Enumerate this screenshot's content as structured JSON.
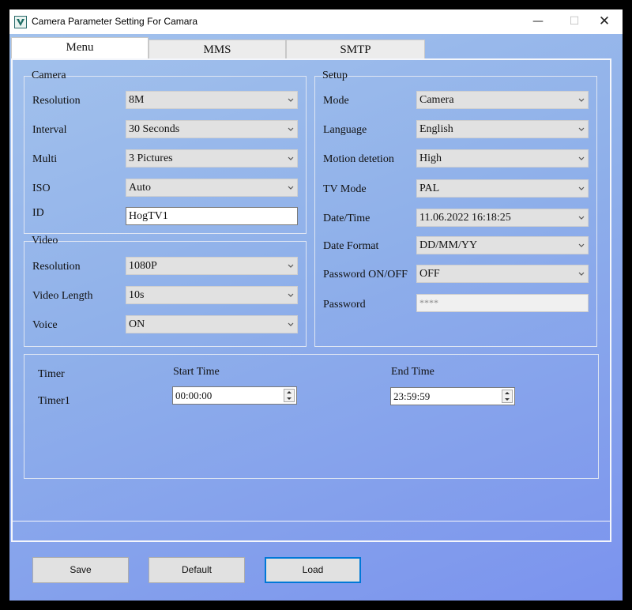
{
  "window": {
    "title": "Camera Parameter Setting For  Camara",
    "controls": {
      "minimize": "—",
      "maximize": "☐",
      "close": "✕"
    }
  },
  "tabs": [
    {
      "label": "Menu",
      "active": true
    },
    {
      "label": "MMS",
      "active": false
    },
    {
      "label": "SMTP",
      "active": false
    }
  ],
  "camera": {
    "title": "Camera",
    "resolution": {
      "label": "Resolution",
      "value": "8M"
    },
    "interval": {
      "label": "Interval",
      "value": "30 Seconds"
    },
    "multi": {
      "label": "Multi",
      "value": "3 Pictures"
    },
    "iso": {
      "label": "ISO",
      "value": "Auto"
    },
    "id": {
      "label": "ID",
      "value": "HogTV1"
    }
  },
  "video": {
    "title": "Video",
    "resolution": {
      "label": "Resolution",
      "value": "1080P"
    },
    "length": {
      "label": "Video Length",
      "value": "10s"
    },
    "voice": {
      "label": "Voice",
      "value": "ON"
    }
  },
  "setup": {
    "title": "Setup",
    "mode": {
      "label": "Mode",
      "value": "Camera"
    },
    "language": {
      "label": "Language",
      "value": "English"
    },
    "motion": {
      "label": "Motion detetion",
      "value": "High"
    },
    "tvmode": {
      "label": "TV Mode",
      "value": "PAL"
    },
    "datetime": {
      "label": "Date/Time",
      "value": "11.06.2022 16:18:25"
    },
    "dateformat": {
      "label": "Date Format",
      "value": "DD/MM/YY"
    },
    "password_onoff": {
      "label": "Password ON/OFF",
      "value": "OFF"
    },
    "password": {
      "label": "Password",
      "value": "****"
    }
  },
  "timer": {
    "label": "Timer",
    "start_label": "Start Time",
    "end_label": "End Time",
    "row_label": "Timer1",
    "start_value": "00:00:00",
    "end_value": "23:59:59"
  },
  "buttons": {
    "save": "Save",
    "default": "Default",
    "load": "Load"
  },
  "colors": {
    "accent": "#0078d7",
    "background_top": "#a4c3ec",
    "background_bottom": "#7b93ee"
  },
  "icons": [
    "app-icon",
    "dropdown-arrow-icon",
    "spin-up-icon",
    "spin-down-icon"
  ]
}
